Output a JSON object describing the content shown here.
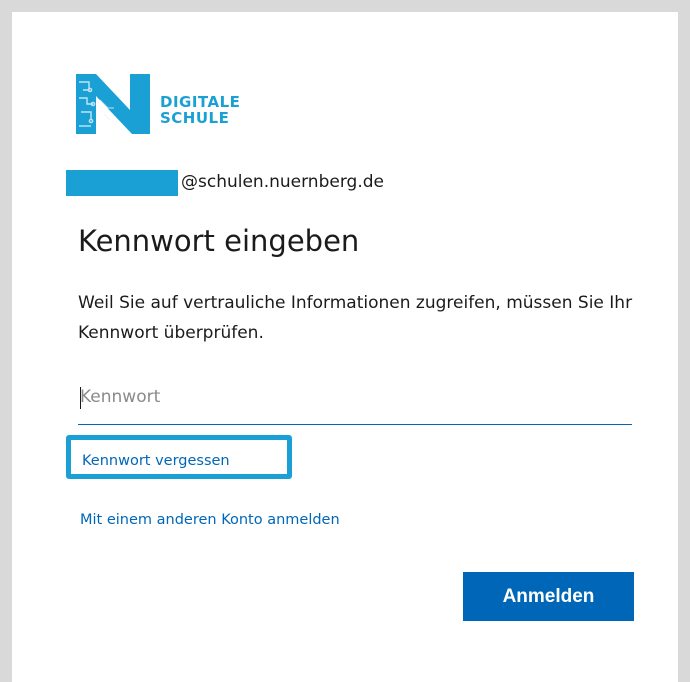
{
  "logo": {
    "line1": "DIGITALE",
    "line2": "SCHULE",
    "icon": "digitale-schule-n-logo",
    "accent_color": "#1aa0d4"
  },
  "account": {
    "email_suffix": "@schulen.nuernberg.de",
    "redaction_color": "#1aa0d4"
  },
  "page": {
    "title": "Kennwort eingeben",
    "description": "Weil Sie auf vertrauliche Informationen zugreifen, müssen Sie Ihr Kennwort überprüfen."
  },
  "password": {
    "placeholder": "Kennwort",
    "value": ""
  },
  "links": {
    "forgot": "Kennwort vergessen",
    "other_account": "Mit einem anderen Konto anmelden"
  },
  "buttons": {
    "signin": "Anmelden"
  },
  "colors": {
    "primary": "#0067b8",
    "highlight": "#1aa0d4"
  }
}
